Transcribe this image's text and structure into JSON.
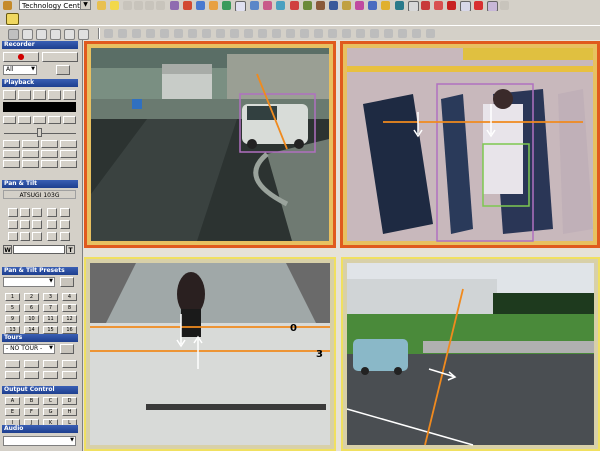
{
  "toolbar": {
    "site_selector": {
      "value": "Technology Center 1"
    }
  },
  "left_panel": {
    "recorder": {
      "title": "Recorder",
      "filter_value": "All"
    },
    "playback": {
      "title": "Playback"
    },
    "pan_tilt": {
      "title": "Pan & Tilt",
      "camera_name": "ATSUGI 103G",
      "wide_label": "W",
      "tele_label": "T"
    },
    "presets": {
      "title": "Pan & Tilt Presets",
      "buttons": [
        "1",
        "2",
        "3",
        "4",
        "5",
        "6",
        "7",
        "8",
        "9",
        "10",
        "11",
        "12",
        "13",
        "14",
        "15",
        "16"
      ]
    },
    "tours": {
      "title": "Tours",
      "value": "- NO TOUR -"
    },
    "output_control": {
      "title": "Output Control",
      "buttons": [
        "A",
        "B",
        "C",
        "D",
        "E",
        "F",
        "G",
        "H",
        "I",
        "J",
        "K",
        "L"
      ]
    },
    "audio": {
      "title": "Audio"
    }
  },
  "video": {
    "tiles": [
      {
        "id": "cam-1",
        "border_color": "#e05a1e"
      },
      {
        "id": "cam-2",
        "border_color": "#e05a1e"
      },
      {
        "id": "cam-3",
        "border_color": "#f0e060"
      },
      {
        "id": "cam-4",
        "border_color": "#f0e060"
      }
    ],
    "line_labels": {
      "entry_line": "0",
      "exit_line": "3"
    }
  },
  "colors": {
    "accent": "#1e3f8f",
    "tripwire": "#f08a1e",
    "detect_box": "#b070c0",
    "detect_box_alt": "#7ec850"
  }
}
